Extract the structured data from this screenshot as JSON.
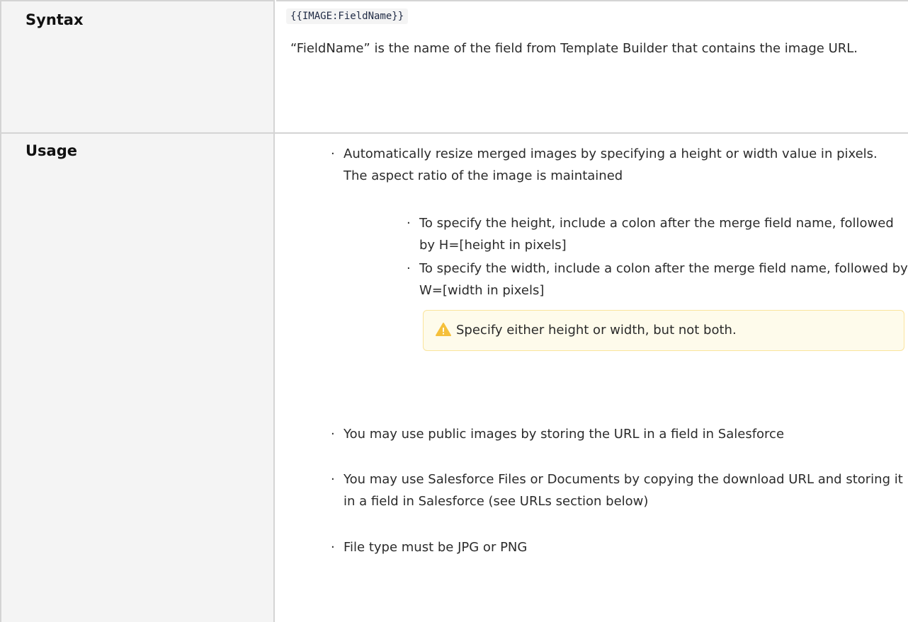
{
  "rows": [
    {
      "label": "Syntax",
      "code": "{{IMAGE:FieldName}}",
      "description": "“FieldName” is the name of the field from Template Builder that contains the image URL."
    },
    {
      "label": "Usage",
      "bullets": [
        {
          "text": "Automatically resize merged images by specifying a height or width value in pixels. The aspect ratio of the image is maintained",
          "sub": [
            "To specify the height, include a colon after the merge field name, followed by H=[height in pixels]",
            "To specify the width, include a colon after the merge field name, followed by W=[width in pixels]"
          ],
          "warning": "Specify either height or width, but not both.",
          "warning_icon": "warning-triangle-icon"
        },
        {
          "text": "You may use public images by storing the URL in a field in Salesforce"
        },
        {
          "text": "You may use Salesforce Files or Documents by copying the download URL and storing it in a field in Salesforce (see URLs section below)"
        },
        {
          "text": "File type must be JPG or PNG"
        }
      ]
    }
  ],
  "colors": {
    "label_bg": "#f4f4f4",
    "border": "#d4d4d4",
    "warning_bg": "#fefbeb",
    "warning_border": "#fae49c",
    "warning_icon": "#f5c03b"
  }
}
